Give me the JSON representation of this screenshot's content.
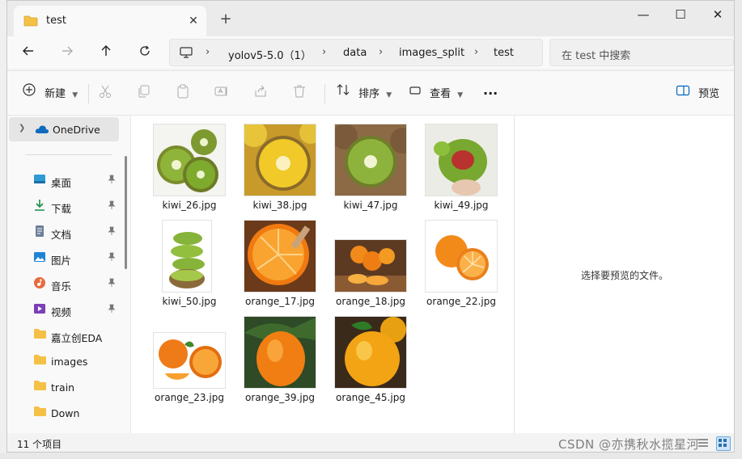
{
  "window": {
    "tab_title": "test",
    "new_tab": "+",
    "minimize": "—",
    "maximize": "☐",
    "close": "✕",
    "tab_close": "✕"
  },
  "address": {
    "crumbs": [
      "yolov5-5.0（1）",
      "data",
      "images_split",
      "test"
    ],
    "separator": "›",
    "search_placeholder": "在 test 中搜索"
  },
  "toolbar": {
    "new_label": "新建",
    "sort_label": "排序",
    "view_label": "查看",
    "more_label": "···",
    "preview_label": "预览"
  },
  "sidebar": {
    "onedrive": "OneDrive",
    "items": [
      {
        "label": "桌面",
        "icon": "desktop-icon",
        "pinned": true
      },
      {
        "label": "下载",
        "icon": "download-icon",
        "pinned": true
      },
      {
        "label": "文档",
        "icon": "document-icon",
        "pinned": true
      },
      {
        "label": "图片",
        "icon": "pictures-icon",
        "pinned": true
      },
      {
        "label": "音乐",
        "icon": "music-icon",
        "pinned": true
      },
      {
        "label": "视频",
        "icon": "video-icon",
        "pinned": true
      },
      {
        "label": "嘉立创EDA",
        "icon": "folder-icon",
        "pinned": false
      },
      {
        "label": "images",
        "icon": "folder-icon",
        "pinned": false
      },
      {
        "label": "train",
        "icon": "folder-icon",
        "pinned": false
      },
      {
        "label": "Down",
        "icon": "folder-icon",
        "pinned": false
      }
    ]
  },
  "files": [
    "kiwi_26.jpg",
    "kiwi_38.jpg",
    "kiwi_47.jpg",
    "kiwi_49.jpg",
    "kiwi_50.jpg",
    "orange_17.jpg",
    "orange_18.jpg",
    "orange_22.jpg",
    "orange_23.jpg",
    "orange_39.jpg",
    "orange_45.jpg"
  ],
  "preview": {
    "message": "选择要预览的文件。"
  },
  "status": {
    "count": "11 个项目"
  },
  "watermark": "CSDN @亦携秋水揽星河",
  "colors": {
    "accent": "#0067c0",
    "folder": "#f4c046",
    "kiwi_green": "#6a9a2a",
    "orange": "#f28a1a"
  }
}
